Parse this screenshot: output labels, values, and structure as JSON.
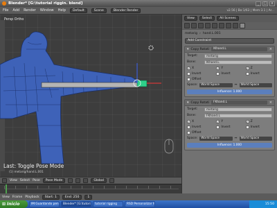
{
  "window": {
    "title": "Blender* [G:\\tutorial riggin. blend]",
    "buttons": [
      "_",
      "□",
      "x"
    ]
  },
  "menubar": {
    "items": [
      "File",
      "Add",
      "Render",
      "Window",
      "Help"
    ],
    "layout": "Default",
    "scene": "Scene",
    "engine": "Blender Render",
    "stats": "v2.56 | Bo:1/63 | Mem:3.1 | Ar..."
  },
  "viewport": {
    "label": "Persp Ortho",
    "last_operation": "Last: Toggle Pose Mode",
    "object_name": "(1) metarig/hand.L.001"
  },
  "view_header": {
    "items": [
      "View",
      "Select",
      "Pose"
    ],
    "mode": "Pose Mode",
    "orientation": "Global"
  },
  "timeline_header": {
    "items": [
      "View",
      "Frame",
      "Playback"
    ],
    "start": "Start: 1",
    "end": "End: 250",
    "current": "1"
  },
  "properties": {
    "top_items": [
      "View",
      "Select",
      "All Scenes"
    ],
    "breadcrumb": [
      "metarig",
      "hand.L.001"
    ],
    "add_constraint": "Add Constraint",
    "constraints": [
      {
        "type": "Copy Rotati",
        "name": "IKhand.L",
        "target_label": "Target:",
        "target": "metarig",
        "bone_label": "Bone:",
        "bone": "IKhand.L",
        "axes": [
          "X",
          "Y",
          "Z"
        ],
        "inverts": [
          "Invert",
          "Invert",
          "Invert"
        ],
        "offset": "Offset",
        "space_label": "Space:",
        "owner_space": "World Space",
        "target_space": "World Space",
        "influence": "Influence: 1.000"
      },
      {
        "type": "Copy Rotati",
        "name": "FKhand.L",
        "target_label": "Target:",
        "target": "metarig",
        "bone_label": "Bone:",
        "bone": "FKhand.L",
        "axes": [
          "X",
          "Y",
          "Z"
        ],
        "inverts": [
          "Invert",
          "Invert",
          "Invert"
        ],
        "offset": "Offset",
        "space_label": "Space:",
        "owner_space": "World Space",
        "target_space": "World Space",
        "influence": "Influence: 1.000"
      }
    ]
  },
  "taskbar": {
    "start": "Inicio",
    "tasks": [
      "IM:Guardando pena...",
      "Blender* [G:\\tutorial...",
      "tutorial rigging",
      "RSD Personalizar hues..."
    ],
    "clock": "15:50"
  }
}
